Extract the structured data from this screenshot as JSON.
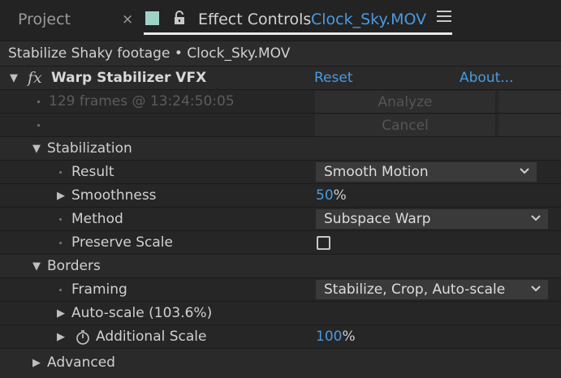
{
  "tabs": {
    "project_label": "Project",
    "close_glyph": "×",
    "swatch_color": "#9fd2c6",
    "effect_controls_label": "Effect Controls",
    "clip_name": "Clock_Sky.MOV"
  },
  "layer_header": "Stabilize Shaky footage • Clock_Sky.MOV",
  "effect": {
    "name": "Warp Stabilizer VFX",
    "reset_label": "Reset",
    "about_label": "About...",
    "status_text": "129 frames @ 13:24:50:05",
    "analyze_label": "Analyze",
    "cancel_label": "Cancel"
  },
  "stabilization": {
    "label": "Stabilization",
    "result_label": "Result",
    "result_value": "Smooth Motion",
    "smoothness_label": "Smoothness",
    "smoothness_value": "50",
    "percent": "%",
    "method_label": "Method",
    "method_value": "Subspace Warp",
    "preserve_scale_label": "Preserve Scale",
    "preserve_scale_checked": false
  },
  "borders": {
    "label": "Borders",
    "framing_label": "Framing",
    "framing_value": "Stabilize, Crop, Auto-scale",
    "autoscale_label": "Auto-scale (103.6%)",
    "additional_scale_label": "Additional Scale",
    "additional_scale_value": "100",
    "percent": "%"
  },
  "advanced": {
    "label": "Advanced"
  }
}
